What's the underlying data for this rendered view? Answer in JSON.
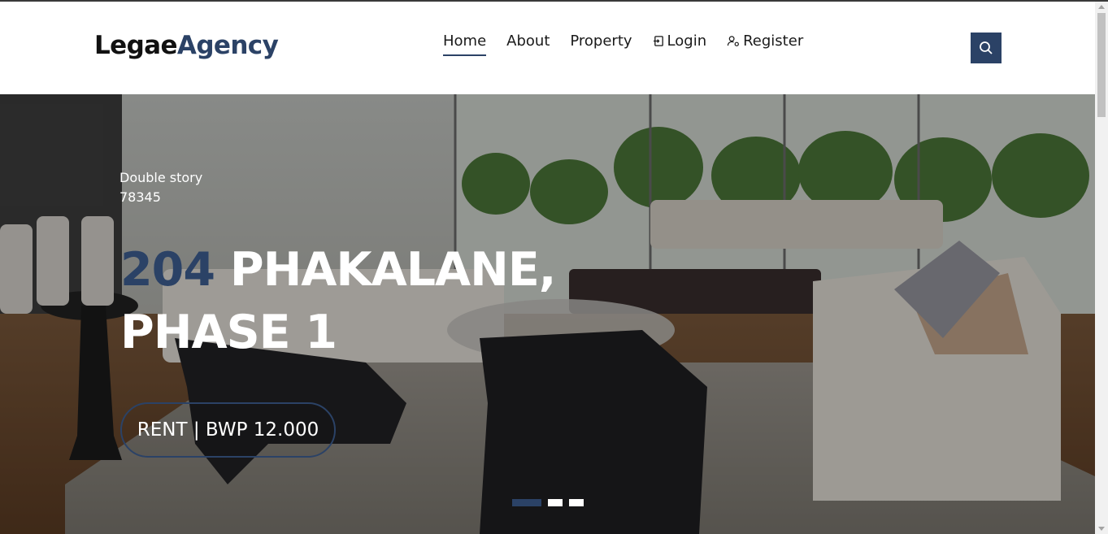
{
  "brand": {
    "part1": "Legae",
    "part2": "Agency"
  },
  "nav": {
    "home": "Home",
    "about": "About",
    "property": "Property",
    "login": "Login",
    "register": "Register"
  },
  "icons": {
    "search": "search-icon",
    "login": "login-icon",
    "register": "user-settings-icon"
  },
  "hero": {
    "kicker_type": "Double story",
    "kicker_code": "78345",
    "title_number": "204",
    "title_line1_rest": " PHAKALANE,",
    "title_line2": "PHASE 1",
    "price_button": "RENT | BWP 12.000",
    "slides_total": 3,
    "slide_active": 1
  },
  "colors": {
    "accent": "#2b4266",
    "text_dark": "#1a1a1a",
    "white": "#ffffff"
  }
}
